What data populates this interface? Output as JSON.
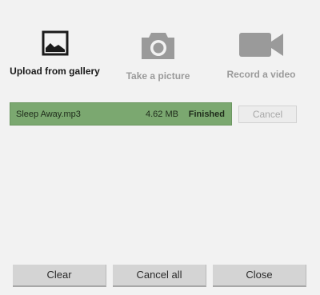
{
  "sources": {
    "gallery": {
      "label": "Upload from gallery",
      "icon": "image-icon"
    },
    "camera": {
      "label": "Take a picture",
      "icon": "camera-icon"
    },
    "video": {
      "label": "Record a video",
      "icon": "video-camera-icon"
    }
  },
  "upload": {
    "file_name": "Sleep Away.mp3",
    "file_size": "4.62 MB",
    "status": "Finished",
    "progress": 1.0,
    "progress_color": "#7ba870",
    "cancel_label": "Cancel"
  },
  "footer": {
    "clear_label": "Clear",
    "cancel_all_label": "Cancel all",
    "close_label": "Close"
  }
}
